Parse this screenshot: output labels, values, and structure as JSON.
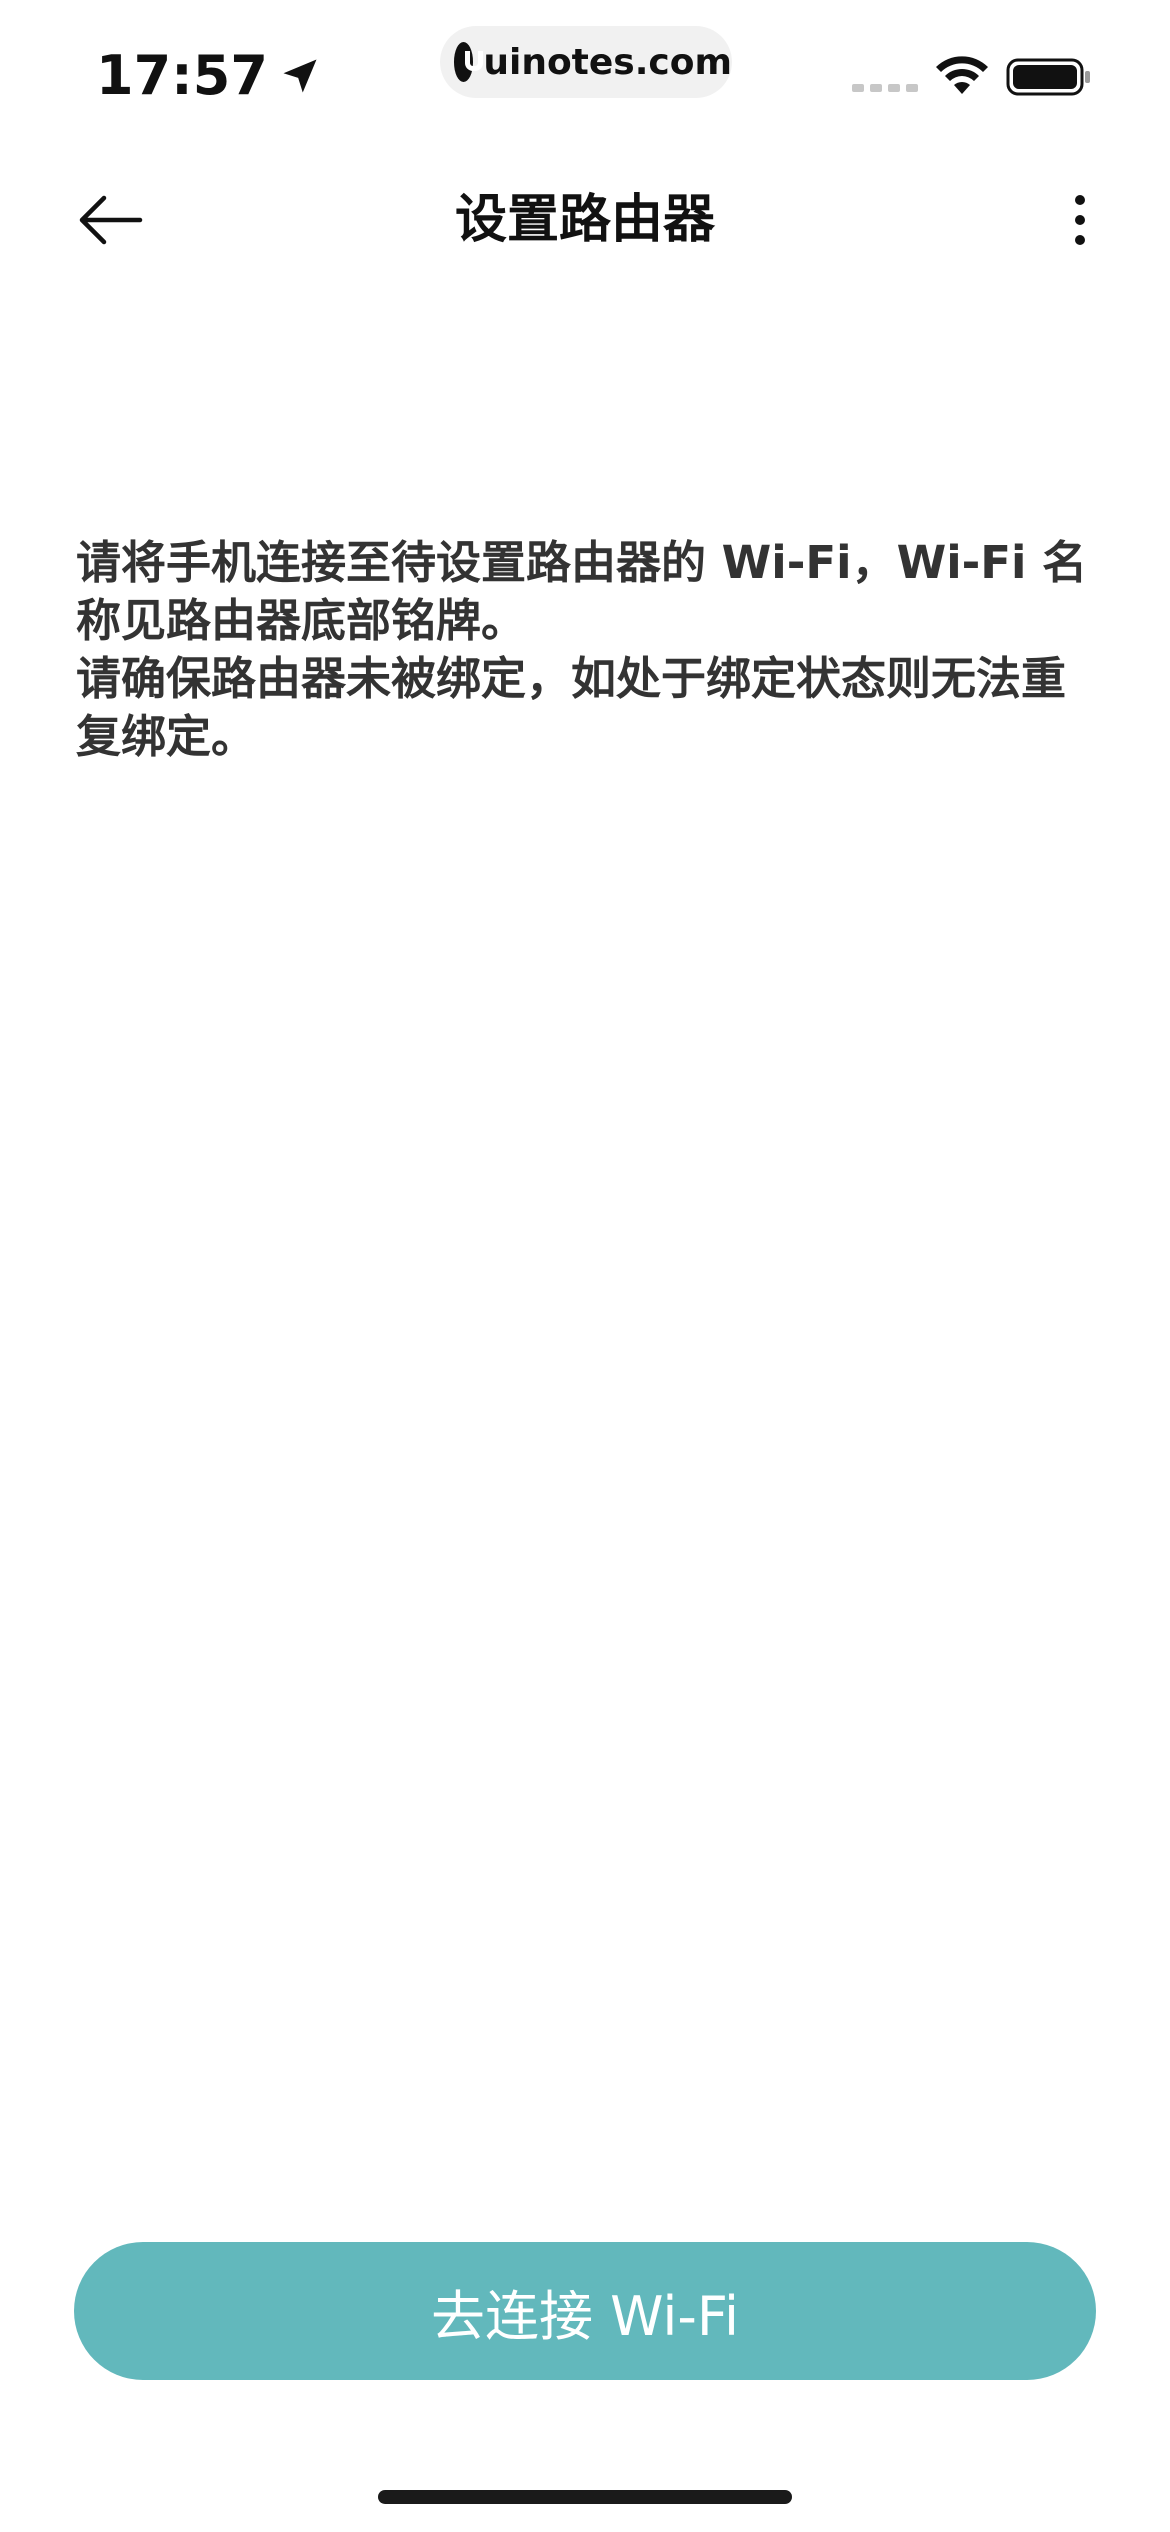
{
  "status_bar": {
    "time": "17:57",
    "site": "uinotes.com"
  },
  "header": {
    "title": "设置路由器"
  },
  "instructions": {
    "line1": "请将手机连接至待设置路由器的 Wi-Fi，Wi-Fi 名称见路由器底部铭牌。",
    "line2": "请确保路由器未被绑定，如处于绑定状态则无法重复绑定。"
  },
  "actions": {
    "connect_label": "去连接 Wi-Fi"
  },
  "colors": {
    "primary": "#62b8bc",
    "text": "#333333",
    "title": "#111111"
  }
}
